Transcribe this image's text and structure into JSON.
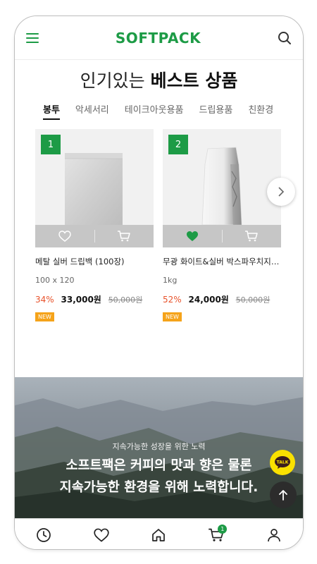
{
  "brand": {
    "logo_text": "SOFTPACK",
    "accent": "#1d9b46"
  },
  "header": {
    "menu_icon": "hamburger-menu-icon",
    "search_icon": "search-icon"
  },
  "section": {
    "title_light": "인기있는",
    "title_bold": "베스트 상품"
  },
  "tabs": [
    {
      "label": "봉투",
      "active": true
    },
    {
      "label": "악세서리",
      "active": false
    },
    {
      "label": "테이크아웃용품",
      "active": false
    },
    {
      "label": "드립용품",
      "active": false
    },
    {
      "label": "친환경",
      "active": false
    }
  ],
  "products": [
    {
      "rank": "1",
      "name": "메탈 실버 드립백 (100장)",
      "spec": "100 x 120",
      "discount": "34%",
      "price": "33,000원",
      "original_price": "50,000원",
      "badge": "NEW",
      "liked": false
    },
    {
      "rank": "2",
      "name": "무광 화이트&실버 박스파우치지…",
      "spec": "1kg",
      "discount": "52%",
      "price": "24,000원",
      "original_price": "50,000원",
      "badge": "NEW",
      "liked": true
    }
  ],
  "banner": {
    "subtitle": "지속가능한 성장을 위한 노력",
    "line1": "소프트팩은 커피의 맛과 향은 물론",
    "line2": "지속가능한 환경을 위해 노력합니다."
  },
  "floating": {
    "talk_label": "TALK",
    "top_icon": "arrow-up-icon"
  },
  "bottom_nav": {
    "items": [
      "clock-icon",
      "heart-icon",
      "home-icon",
      "cart-icon",
      "user-icon"
    ],
    "cart_count": "1"
  }
}
